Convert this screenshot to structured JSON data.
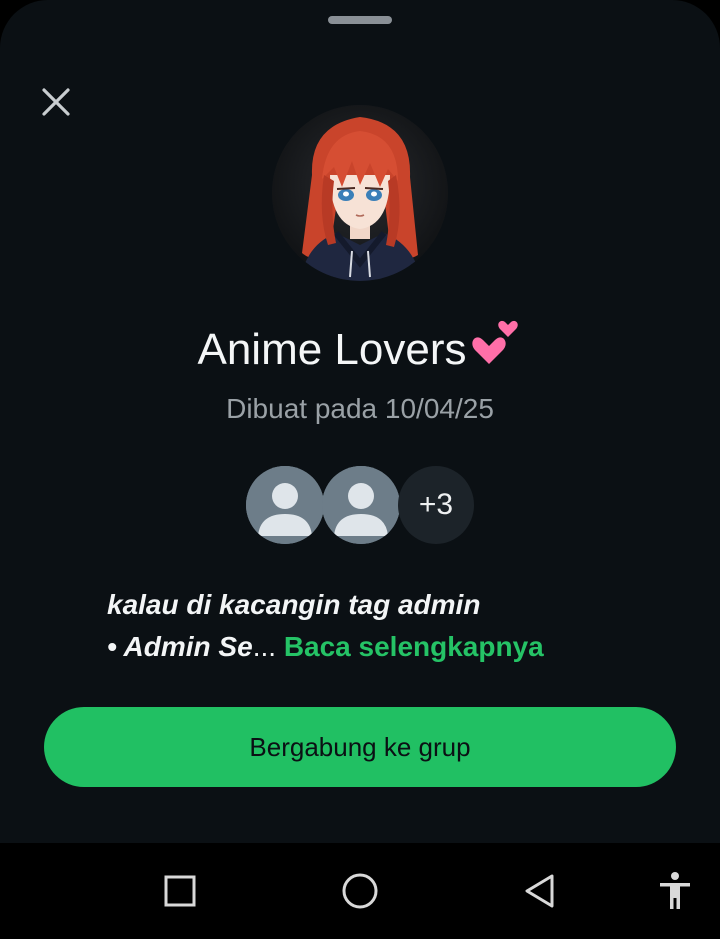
{
  "sheet": {
    "background_color": "#0b1014",
    "handle_icon": "drag-handle"
  },
  "header": {
    "close_icon": "close-icon"
  },
  "group": {
    "name": "Anime Lovers",
    "name_emoji": "💕",
    "created_label": "Dibuat pada 10/04/25",
    "avatar_description_icon": "anime-girl-avatar"
  },
  "members": {
    "avatars": [
      "person-placeholder-icon",
      "person-placeholder-icon"
    ],
    "more_count": "+3"
  },
  "description": {
    "line1": "kalau di kacangin tag admin",
    "line2_prefix": "• Admin Se",
    "ellipsis": "...",
    "read_more": "Baca selengkapnya"
  },
  "actions": {
    "join_label": "Bergabung ke grup",
    "accent_color": "#21c063"
  },
  "system_nav": {
    "items": [
      "recent-apps-icon",
      "home-icon",
      "back-icon",
      "accessibility-icon"
    ]
  }
}
